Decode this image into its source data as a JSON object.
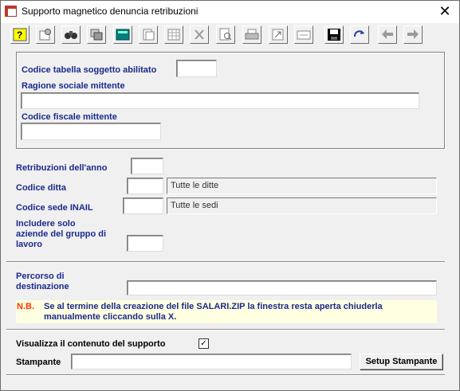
{
  "window": {
    "title": "Supporto magnetico denuncia retribuzioni",
    "close_glyph": "✕"
  },
  "toolbar": {
    "buttons": [
      "help-icon",
      "preferences-icon",
      "binoculars-icon",
      "copy-records-icon",
      "calculator-icon",
      "paste-icon",
      "table-grid-icon",
      "delete-icon",
      "print-preview-icon",
      "printer-icon",
      "export-icon",
      "form-icon",
      "save-icon",
      "refresh-icon",
      "back-arrow-icon",
      "forward-arrow-icon"
    ]
  },
  "header_box": {
    "codice_tabella_label": "Codice tabella soggetto abilitato",
    "codice_tabella_value": "",
    "ragione_sociale_label": "Ragione sociale mittente",
    "ragione_sociale_value": "",
    "codice_fiscale_label": "Codice fiscale mittente",
    "codice_fiscale_value": ""
  },
  "form": {
    "retribuzioni_label": "Retribuzioni dell'anno",
    "retribuzioni_value": "",
    "codice_ditta_label": "Codice ditta",
    "codice_ditta_value": "",
    "codice_ditta_desc": "Tutte le ditte",
    "codice_sede_label": "Codice sede INAIL",
    "codice_sede_value": "",
    "codice_sede_desc": "Tutte le sedi",
    "includere_label_1": "Includere solo",
    "includere_label_2": "aziende del gruppo di",
    "includere_label_3": "lavoro",
    "includere_value": ""
  },
  "destination": {
    "percorso_label_1": "Percorso di",
    "percorso_label_2": "destinazione",
    "percorso_value": "",
    "nb_label": "N.B.",
    "nb_text": "Se al termine della creazione del file SALARI.ZIP la finestra resta aperta chiuderla manualmente cliccando sulla X."
  },
  "output": {
    "visualizza_label": "Visualizza il contenuto del supporto",
    "visualizza_checked": true,
    "check_glyph": "✓",
    "stampante_label": "Stampante",
    "stampante_value": "",
    "setup_button": "Setup Stampante"
  },
  "colors": {
    "label_blue": "#1a2a8c",
    "note_bg": "#ffffe1",
    "nb_red": "#ff3300",
    "window_bg": "#f0f0f0"
  }
}
